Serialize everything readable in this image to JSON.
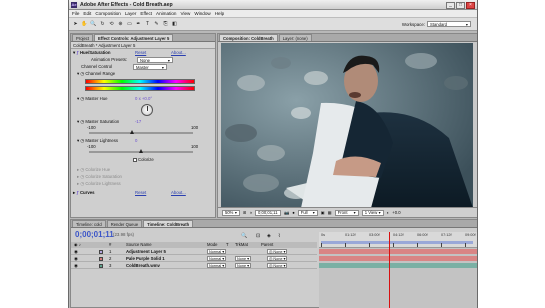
{
  "window": {
    "title": "Adobe After Effects - Cold Breath.aep",
    "logo": "Ae"
  },
  "window_buttons": [
    "_",
    "□",
    "×"
  ],
  "menu": [
    "File",
    "Edit",
    "Composition",
    "Layer",
    "Effect",
    "Animation",
    "View",
    "Window",
    "Help"
  ],
  "toolbar": {
    "workspace_label": "Workspace:",
    "workspace_value": "Standard"
  },
  "left_panel": {
    "tabs": [
      "Project",
      "Effect Controls: Adjustment Layer 5"
    ],
    "header": "ColdBreath * Adjustment Layer 5",
    "hue_sat": {
      "label": "Hue/Saturation",
      "reset": "Reset",
      "about": "About..."
    },
    "animation_presets": {
      "label": "Animation Presets:",
      "value": "None"
    },
    "channel_control": {
      "label": "Channel Control",
      "value": "Master"
    },
    "channel_range": "Channel Range",
    "master_hue": {
      "label": "Master Hue",
      "value": "0 x +0.0°"
    },
    "master_saturation": {
      "label": "Master Saturation",
      "value": "-17",
      "min": "-100",
      "max": "100",
      "level": 0.415
    },
    "master_lightness": {
      "label": "Master Lightness",
      "value": "0",
      "min": "-100",
      "max": "100",
      "level": 0.5
    },
    "colorize": "Colorize",
    "colorize_hue": "Colorize Hue",
    "colorize_saturation": "Colorize Saturation",
    "colorize_lightness": "Colorize Lightness",
    "curves": {
      "label": "Curves",
      "reset": "Reset",
      "about": "About..."
    }
  },
  "comp_panel": {
    "tabs": [
      "Composition: ColdBreath",
      "Layer: (none)"
    ],
    "bottom_bar": {
      "zoom": "50%",
      "time": "0;00;01;11",
      "res": "Full",
      "view": "Front",
      "views": "1 View",
      "exposure": "+0.0"
    }
  },
  "timeline": {
    "tabs": [
      "Timeline: cold",
      "Render Queue",
      "Timeline: ColdBreath"
    ],
    "timecode": "0;00;01;11",
    "fps": "(23.98 fps)",
    "columns": [
      "#",
      "Source Name",
      "Mode",
      "T",
      "TrkMat",
      "Parent"
    ],
    "layers": [
      {
        "num": "1",
        "name": "Adjustment Layer 5",
        "mode": "Normal",
        "trkmat": "",
        "parent": "None",
        "color": "#b5a7e0",
        "bar": "#d98585"
      },
      {
        "num": "2",
        "name": "Pale Purple Solid 1",
        "mode": "Normal",
        "trkmat": "None",
        "parent": "None",
        "color": "#d37b7b",
        "bar": "#d98585"
      },
      {
        "num": "3",
        "name": "ColdBreath.wmv",
        "mode": "Normal",
        "trkmat": "None",
        "parent": "None",
        "color": "#5fa58f",
        "bar": "#7ab0a4"
      }
    ],
    "ruler_labels": [
      "0s",
      "01:12f",
      "03:00f",
      "04:12f",
      "06:00f",
      "07:12f",
      "09:00f"
    ]
  }
}
